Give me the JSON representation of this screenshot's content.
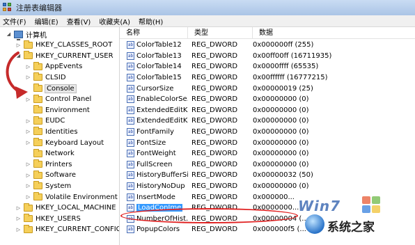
{
  "window": {
    "title": "注册表编辑器"
  },
  "menu": [
    "文件(F)",
    "编辑(E)",
    "查看(V)",
    "收藏夹(A)",
    "帮助(H)"
  ],
  "tree": {
    "root": "计算机",
    "items": [
      {
        "label": "HKEY_CLASSES_ROOT",
        "level": 1,
        "expander": "right",
        "icon": "folder-icon"
      },
      {
        "label": "HKEY_CURRENT_USER",
        "level": 1,
        "expander": "down",
        "icon": "folder-icon"
      },
      {
        "label": "AppEvents",
        "level": 2,
        "expander": "right",
        "icon": "folder-icon"
      },
      {
        "label": "CLSID",
        "level": 2,
        "expander": "right",
        "icon": "folder-icon"
      },
      {
        "label": "Console",
        "level": 2,
        "expander": "none",
        "icon": "folder-icon",
        "selected": true
      },
      {
        "label": "Control Panel",
        "level": 2,
        "expander": "right",
        "icon": "folder-icon"
      },
      {
        "label": "Environment",
        "level": 2,
        "expander": "none",
        "icon": "folder-icon"
      },
      {
        "label": "EUDC",
        "level": 2,
        "expander": "right",
        "icon": "folder-icon"
      },
      {
        "label": "Identities",
        "level": 2,
        "expander": "right",
        "icon": "folder-icon"
      },
      {
        "label": "Keyboard Layout",
        "level": 2,
        "expander": "right",
        "icon": "folder-icon"
      },
      {
        "label": "Network",
        "level": 2,
        "expander": "none",
        "icon": "folder-icon"
      },
      {
        "label": "Printers",
        "level": 2,
        "expander": "right",
        "icon": "folder-icon"
      },
      {
        "label": "Software",
        "level": 2,
        "expander": "right",
        "icon": "folder-icon"
      },
      {
        "label": "System",
        "level": 2,
        "expander": "right",
        "icon": "folder-icon"
      },
      {
        "label": "Volatile Environment",
        "level": 2,
        "expander": "right",
        "icon": "folder-icon"
      },
      {
        "label": "HKEY_LOCAL_MACHINE",
        "level": 1,
        "expander": "right",
        "icon": "folder-icon"
      },
      {
        "label": "HKEY_USERS",
        "level": 1,
        "expander": "right",
        "icon": "folder-icon"
      },
      {
        "label": "HKEY_CURRENT_CONFIG",
        "level": 1,
        "expander": "right",
        "icon": "folder-icon"
      }
    ]
  },
  "list": {
    "headers": {
      "name": "名称",
      "type": "类型",
      "data": "数据"
    },
    "rows": [
      {
        "name": "ColorTable12",
        "type": "REG_DWORD",
        "data": "0x000000ff (255)"
      },
      {
        "name": "ColorTable13",
        "type": "REG_DWORD",
        "data": "0x00ff00ff (16711935)"
      },
      {
        "name": "ColorTable14",
        "type": "REG_DWORD",
        "data": "0x0000ffff (65535)"
      },
      {
        "name": "ColorTable15",
        "type": "REG_DWORD",
        "data": "0x00ffffff (16777215)"
      },
      {
        "name": "CursorSize",
        "type": "REG_DWORD",
        "data": "0x00000019 (25)"
      },
      {
        "name": "EnableColorSe...",
        "type": "REG_DWORD",
        "data": "0x00000000 (0)"
      },
      {
        "name": "ExtendedEditK...",
        "type": "REG_DWORD",
        "data": "0x00000000 (0)"
      },
      {
        "name": "ExtendedEditK...",
        "type": "REG_DWORD",
        "data": "0x00000000 (0)"
      },
      {
        "name": "FontFamily",
        "type": "REG_DWORD",
        "data": "0x00000000 (0)"
      },
      {
        "name": "FontSize",
        "type": "REG_DWORD",
        "data": "0x00000000 (0)"
      },
      {
        "name": "FontWeight",
        "type": "REG_DWORD",
        "data": "0x00000000 (0)"
      },
      {
        "name": "FullScreen",
        "type": "REG_DWORD",
        "data": "0x00000000 (0)"
      },
      {
        "name": "HistoryBufferSi...",
        "type": "REG_DWORD",
        "data": "0x00000032 (50)"
      },
      {
        "name": "HistoryNoDup",
        "type": "REG_DWORD",
        "data": "0x00000000 (0)"
      },
      {
        "name": "InsertMode",
        "type": "REG_DWORD",
        "data": "0x000000..."
      },
      {
        "name": "LoadConIme",
        "type": "REG_DWORD",
        "data": "0x0000000...",
        "highlighted": true
      },
      {
        "name": "NumberOfHist...",
        "type": "REG_DWORD",
        "data": "0x00000004 (..."
      },
      {
        "name": "PopupColors",
        "type": "REG_DWORD",
        "data": "0x000000f5 (..."
      }
    ],
    "value_icon": "ab"
  },
  "watermark": {
    "top": "Win7",
    "bottom": "系统之家"
  }
}
